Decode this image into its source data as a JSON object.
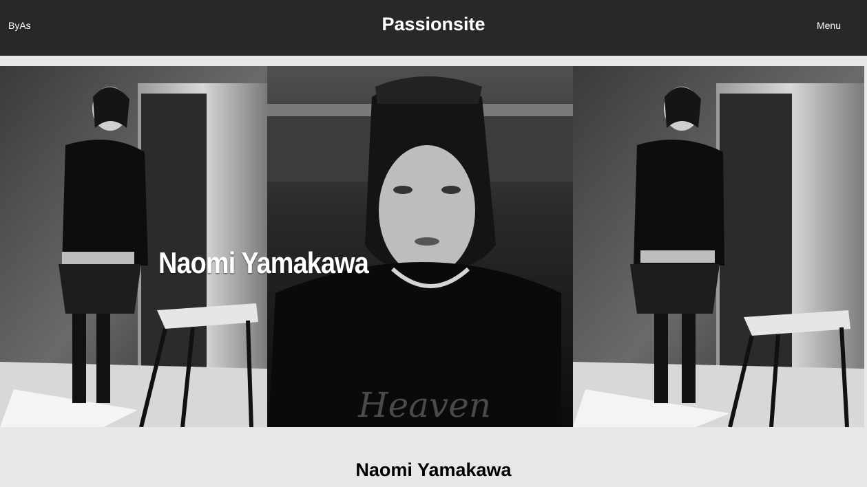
{
  "header": {
    "brand": "ByAs",
    "title": "Passionsite",
    "menu_label": "Menu"
  },
  "hero": {
    "overlay_title": "Naomi Yamakawa"
  },
  "main": {
    "heading": "Naomi Yamakawa"
  },
  "colors": {
    "header_bg": "#282828",
    "page_bg": "#e8e7e7",
    "text_light": "#ffffff",
    "text_dark": "#000000"
  }
}
